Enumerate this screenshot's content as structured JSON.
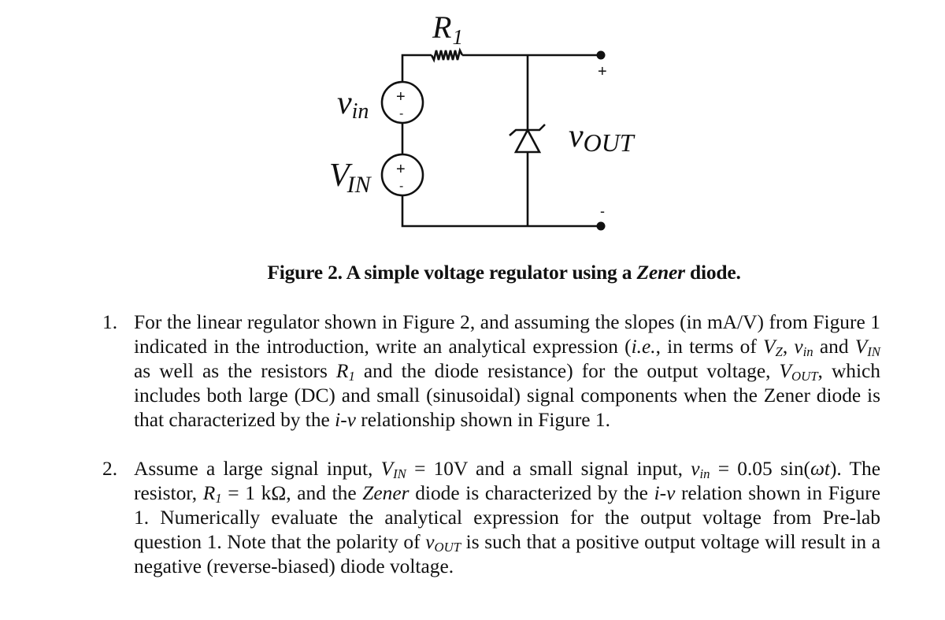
{
  "figure": {
    "labels": {
      "resistor": "R",
      "resistor_sub": "1",
      "small_source": "v",
      "small_source_sub": "in",
      "large_source": "V",
      "large_source_sub": "IN",
      "output": "v",
      "output_sub": "OUT",
      "out_plus": "+",
      "out_minus": "-",
      "source_plus": "+",
      "source_minus": "-"
    },
    "caption_prefix": "Figure 2. A simple voltage regulator using a ",
    "caption_emph": "Zener",
    "caption_suffix": " diode."
  },
  "questions": [
    {
      "number": "1.",
      "parts": {
        "t1": "For the linear regulator shown in Figure 2, and assuming the slopes (in mA/V) from Figure 1 indicated in the introduction, write an analytical expression (",
        "ie": "i.e.",
        "t2": ", in terms of ",
        "vz": "V",
        "vz_sub": "Z",
        "t3": ", ",
        "vin": "v",
        "vin_sub": "in",
        "t4": " and ",
        "VIN": "V",
        "VIN_sub": "IN",
        "t5": " as well as the resistors ",
        "r1": "R",
        "r1_sub": "1",
        "t6": " and the diode resistance) for the output voltage, ",
        "vout": "V",
        "vout_sub": "OUT",
        "t7": ", which includes both large (DC) and small (sinusoidal) signal components when the Zener diode is that characterized by the ",
        "iv": "i-v",
        "t8": " relationship shown in Figure 1."
      }
    },
    {
      "number": "2.",
      "parts": {
        "t1": "Assume a large signal input, ",
        "VIN": "V",
        "VIN_sub": "IN",
        "t2": " = 10V and a small signal input, ",
        "vin": "v",
        "vin_sub": "in",
        "t3": " = 0.05 sin(",
        "wt": "ωt",
        "t4": "). The resistor, ",
        "r1": "R",
        "r1_sub": "1",
        "t5": " = 1 kΩ, and the ",
        "zener": "Zener",
        "t6": " diode is characterized by the ",
        "iv": "i-v",
        "t7": " relation shown in Figure 1. Numerically evaluate the analytical expression for the output voltage from Pre-lab question 1. Note that the polarity of ",
        "vout": "v",
        "vout_sub": "OUT",
        "t8": " is such that a positive output voltage will result in a negative (reverse-biased) diode voltage."
      }
    }
  ]
}
